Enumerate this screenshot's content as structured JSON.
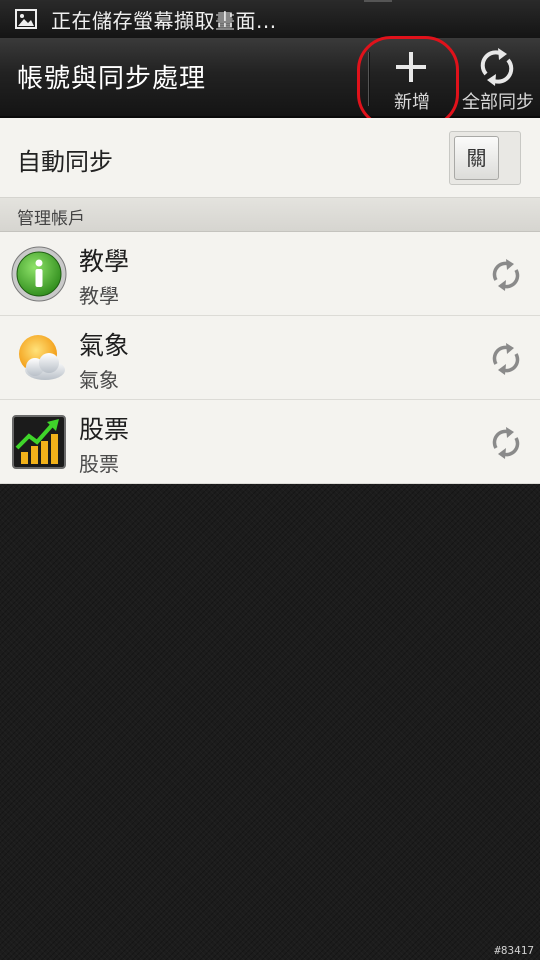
{
  "status_bar": {
    "text": "正在儲存螢幕擷取畫面...",
    "icon": "image-icon"
  },
  "action_bar": {
    "title": "帳號與同步處理",
    "add_label": "新增",
    "sync_all_label": "全部同步",
    "highlight_color": "#e0121b"
  },
  "auto_sync": {
    "label": "自動同步",
    "toggle_state": "關"
  },
  "manage_section": {
    "title": "管理帳戶"
  },
  "accounts": [
    {
      "name": "教學",
      "type": "教學",
      "icon": "info-icon"
    },
    {
      "name": "氣象",
      "type": "氣象",
      "icon": "weather-icon"
    },
    {
      "name": "股票",
      "type": "股票",
      "icon": "stocks-icon"
    }
  ],
  "watermark": "#83417"
}
